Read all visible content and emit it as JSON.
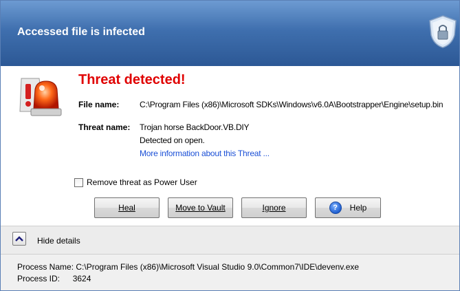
{
  "title": "Accessed file is infected",
  "heading": "Threat detected!",
  "file_name_label": "File name:",
  "file_name": "C:\\Program Files (x86)\\Microsoft SDKs\\Windows\\v6.0A\\Bootstrapper\\Engine\\setup.bin",
  "threat_name_label": "Threat name:",
  "threat_name": "Trojan horse BackDoor.VB.DIY",
  "detected": "Detected on open.",
  "more_info_link": "More information about this Threat ...",
  "checkbox_label": "Remove threat as Power User",
  "buttons": {
    "heal": "Heal",
    "vault": "Move to Vault",
    "ignore": "Ignore",
    "help": "Help"
  },
  "details_toggle": "Hide details",
  "process_name_label": "Process Name:",
  "process_name": "C:\\Program Files (x86)\\Microsoft Visual Studio 9.0\\Common7\\IDE\\devenv.exe",
  "process_id_label": "Process ID:",
  "process_id": "3624",
  "colors": {
    "accent": "#3f6fae",
    "threat": "#e00000",
    "link": "#1a4fd6"
  }
}
